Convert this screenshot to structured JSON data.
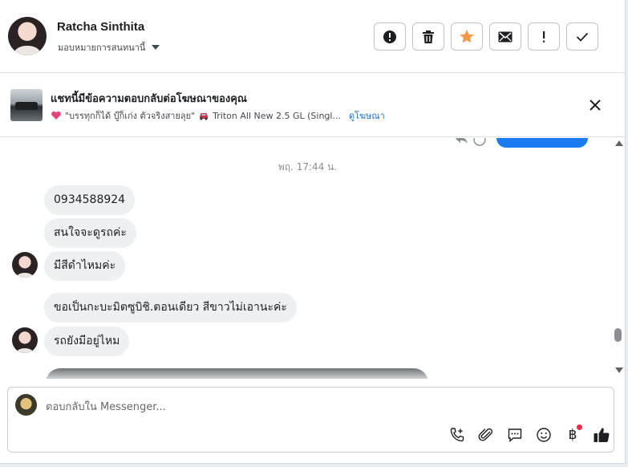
{
  "header": {
    "contact_name": "Ratcha Sinthita",
    "assign_label": "มอบหมายการสนทนานี้",
    "actions": [
      {
        "name": "spam-button",
        "icon": "alert-circle-icon"
      },
      {
        "name": "delete-button",
        "icon": "trash-icon"
      },
      {
        "name": "star-button",
        "icon": "star-icon"
      },
      {
        "name": "mark-unread-button",
        "icon": "envelope-icon"
      },
      {
        "name": "follow-up-button",
        "icon": "exclamation-icon"
      },
      {
        "name": "mark-done-button",
        "icon": "check-icon"
      }
    ],
    "star_color": "#f2994a"
  },
  "ad_banner": {
    "title": "แชทนี้มีข้อความตอบกลับต่อโฆษณาของคุณ",
    "ad_text": "\"บรรทุกก็ได้ บู๊ก็เก่ง ตัวจริงสายลุย\"",
    "ad_vehicle": "Triton All New 2.5 GL (Singl...",
    "view_ad_link": "ดูโฆษณา"
  },
  "chat": {
    "timestamp": "พฤ. 17:44 น.",
    "messages": [
      {
        "text": "0934588924"
      },
      {
        "text": "สนใจจะดูรถค่ะ"
      },
      {
        "text": "มีสีดำไหมค่ะ"
      },
      {
        "text": "ขอเป็นกะบะมิตซูบิชิ.ตอนเดียว สีขาวไม่เอานะค่ะ"
      },
      {
        "text": "รถยังมีอยู่ไหม"
      }
    ],
    "accent_color": "#1b7cf2"
  },
  "composer": {
    "placeholder": "ตอบกลับใน Messenger..."
  }
}
